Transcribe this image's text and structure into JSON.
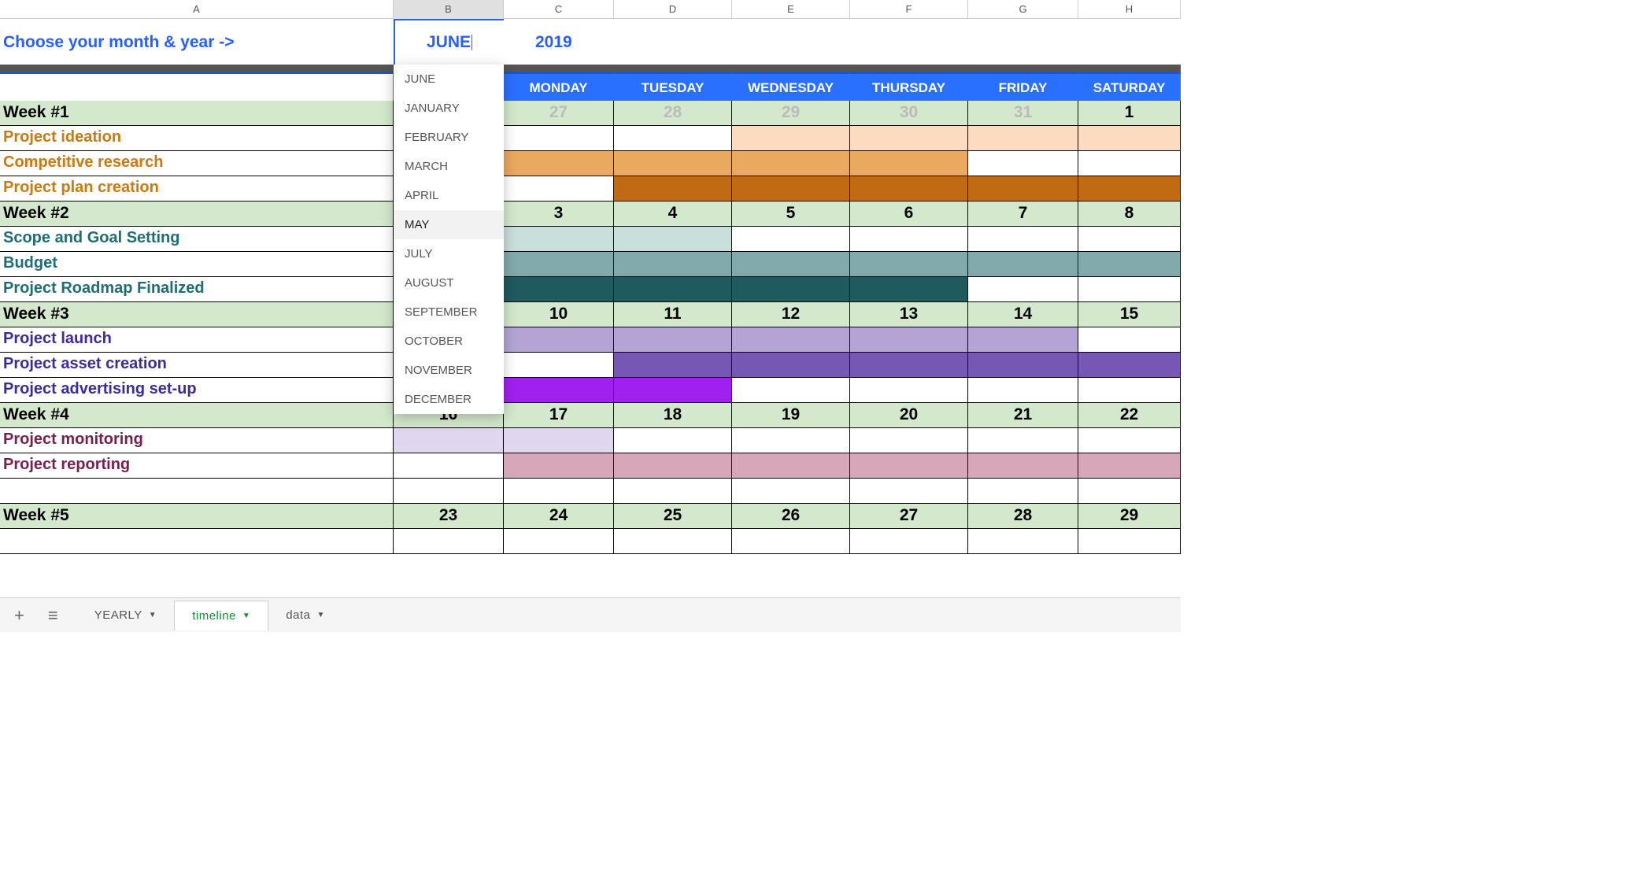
{
  "columns": [
    "A",
    "B",
    "C",
    "D",
    "E",
    "F",
    "G",
    "H"
  ],
  "active_column": "B",
  "picker": {
    "label": "Choose your month & year ->",
    "month": "JUNE",
    "year": "2019"
  },
  "dropdown_options": [
    "JUNE",
    "JANUARY",
    "FEBRUARY",
    "MARCH",
    "APRIL",
    "MAY",
    "JULY",
    "AUGUST",
    "SEPTEMBER",
    "OCTOBER",
    "NOVEMBER",
    "DECEMBER"
  ],
  "dropdown_hovered": "MAY",
  "days": [
    "",
    "",
    "MONDAY",
    "TUESDAY",
    "WEDNESDAY",
    "THURSDAY",
    "FRIDAY",
    "SATURDAY"
  ],
  "weeks": [
    {
      "label": "Week #1",
      "dates": [
        "",
        "27",
        "28",
        "29",
        "30",
        "31",
        "1"
      ],
      "faded_idx": [
        1,
        2,
        3,
        4,
        5
      ],
      "tasks": [
        {
          "label": "Project ideation",
          "class": "c-orange1",
          "fills": [
            "",
            "",
            "",
            "f-peach",
            "f-peach",
            "f-peach",
            "f-peach"
          ]
        },
        {
          "label": "Competitive research",
          "class": "c-orange2",
          "fills": [
            "",
            "f-orange",
            "f-orange",
            "f-orange",
            "f-orange",
            "",
            ""
          ]
        },
        {
          "label": "Project plan creation",
          "class": "c-orange3",
          "fills": [
            "",
            "",
            "f-dkorange",
            "f-dkorange",
            "f-dkorange",
            "f-dkorange",
            "f-dkorange"
          ]
        }
      ]
    },
    {
      "label": "Week #2",
      "dates": [
        "",
        "3",
        "4",
        "5",
        "6",
        "7",
        "8"
      ],
      "faded_idx": [],
      "tasks": [
        {
          "label": "Scope and Goal Setting",
          "class": "c-teal1",
          "fills": [
            "f-ltteal",
            "f-ltteal",
            "f-ltteal",
            "",
            "",
            "",
            ""
          ]
        },
        {
          "label": "Budget",
          "class": "c-teal2",
          "fills": [
            "f-teal",
            "f-teal",
            "f-teal",
            "f-teal",
            "f-teal",
            "f-teal",
            "f-teal"
          ]
        },
        {
          "label": "Project Roadmap Finalized",
          "class": "c-teal3",
          "fills": [
            "f-dkteal",
            "f-dkteal",
            "f-dkteal",
            "f-dkteal",
            "f-dkteal",
            "",
            ""
          ]
        }
      ]
    },
    {
      "label": "Week #3",
      "dates": [
        "",
        "10",
        "11",
        "12",
        "13",
        "14",
        "15"
      ],
      "faded_idx": [],
      "tasks": [
        {
          "label": "Project launch",
          "class": "c-purple1",
          "fills": [
            "f-lav",
            "f-lav",
            "f-lav",
            "f-lav",
            "f-lav",
            "f-lav",
            ""
          ]
        },
        {
          "label": "Project asset creation",
          "class": "c-purple2",
          "fills": [
            "",
            "",
            "f-purple",
            "f-purple",
            "f-purple",
            "f-purple",
            "f-purple"
          ]
        },
        {
          "label": "Project advertising set-up",
          "class": "c-purple3",
          "fills": [
            "f-violet",
            "f-violet",
            "f-violet",
            "",
            "",
            "",
            ""
          ]
        }
      ]
    },
    {
      "label": "Week #4",
      "dates": [
        "16",
        "17",
        "18",
        "19",
        "20",
        "21",
        "22"
      ],
      "faded_idx": [],
      "tasks": [
        {
          "label": "Project monitoring",
          "class": "c-maroon1",
          "fills": [
            "f-ltpurple",
            "f-ltpurple",
            "",
            "",
            "",
            "",
            ""
          ]
        },
        {
          "label": "Project reporting",
          "class": "c-maroon2",
          "fills": [
            "",
            "f-pink",
            "f-pink",
            "f-pink",
            "f-pink",
            "f-pink",
            "f-pink"
          ]
        }
      ]
    },
    {
      "label": "Week #5",
      "dates": [
        "23",
        "24",
        "25",
        "26",
        "27",
        "28",
        "29"
      ],
      "faded_idx": [],
      "tasks": []
    }
  ],
  "sheets": [
    {
      "name": "YEARLY",
      "active": false
    },
    {
      "name": "timeline",
      "active": true
    },
    {
      "name": "data",
      "active": false
    }
  ]
}
